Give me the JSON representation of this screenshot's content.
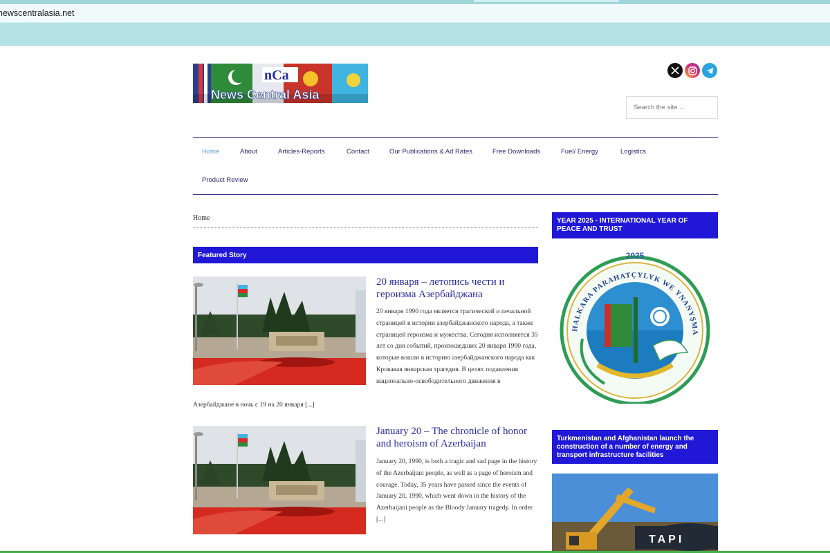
{
  "browser": {
    "url": "newscentralasia.net"
  },
  "header": {
    "logo_text": "News Central Asia",
    "logo_mark": "nCa",
    "social_icons": [
      "x-icon",
      "instagram-icon",
      "telegram-icon"
    ],
    "search_placeholder": "Search the site ..."
  },
  "nav": {
    "items": [
      {
        "label": "Home",
        "active": true
      },
      {
        "label": "About"
      },
      {
        "label": "Articles-Reports"
      },
      {
        "label": "Contact"
      },
      {
        "label": "Our Publications & Ad Rates"
      },
      {
        "label": "Free Downloads"
      },
      {
        "label": "Fuel/ Energy"
      },
      {
        "label": "Logistics"
      },
      {
        "label": "Product Review"
      }
    ]
  },
  "main": {
    "breadcrumb": "Home",
    "featured_label": "Featured Story",
    "posts": [
      {
        "title": "20 января – летопись чести и героизма Азербайджана",
        "excerpt": "20 января 1990 года является трагической и печальной страницей в истории азербайджанского народа, а также страницей героизма и мужества. Сегодня исполняется 35 лет со дня событий, произошедших 20 января 1990 года, которые вошли в историю азербайджанского народа как Кровавая январская трагедия. В целях подавления национально-освободительного движения в",
        "tail": "Азербайджане в ночь с 19 на 20 января [...]"
      },
      {
        "title": "January 20 – The chronicle of honor and heroism of Azerbaijan",
        "excerpt": "January 20, 1990, is both a tragic and sad page in the history of the Azerbaijani people, as well as a page of heroism and courage. Today, 35 years have passed since the events of January 20, 1990, which went down in the history of the Azerbaijani people as the Bloody January tragedy. In order [...]"
      }
    ]
  },
  "sidebar": {
    "widget1_title": "YEAR 2025 - INTERNATIONAL YEAR OF PEACE AND TRUST",
    "emblem_year": "2025",
    "emblem_text": "HALKARA PARAHATÇYLYK WE YNANYŞMAK ÝYLY",
    "widget2_title": "Turkmenistan and Afghanistan launch the construction of a number of energy and transport infrastructure facilities",
    "photo_text": "TAPI"
  }
}
